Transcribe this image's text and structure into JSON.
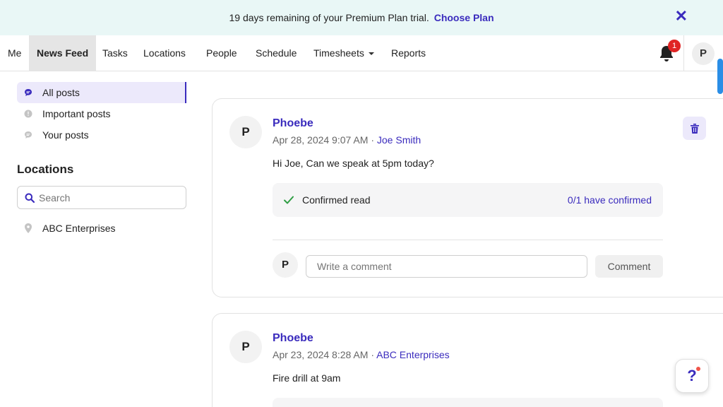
{
  "banner": {
    "text": "19 days remaining of your Premium Plan trial.",
    "link": "Choose Plan",
    "close_icon": "close-icon"
  },
  "nav": {
    "items": [
      {
        "label": "Me"
      },
      {
        "label": "News Feed",
        "active": true
      },
      {
        "label": "Tasks"
      },
      {
        "label": "Locations"
      },
      {
        "label": "People"
      },
      {
        "label": "Schedule"
      },
      {
        "label": "Timesheets",
        "dropdown": true
      },
      {
        "label": "Reports"
      }
    ],
    "notification_count": "1",
    "avatar_initial": "P"
  },
  "sidebar": {
    "filters": [
      {
        "label": "All posts",
        "icon": "chat-bubble-icon",
        "active": true
      },
      {
        "label": "Important posts",
        "icon": "alert-circle-icon"
      },
      {
        "label": "Your posts",
        "icon": "chat-bubble-icon"
      }
    ],
    "locations_heading": "Locations",
    "search_placeholder": "Search",
    "locations": [
      {
        "label": "ABC Enterprises",
        "icon": "map-pin-icon"
      }
    ]
  },
  "posts": [
    {
      "avatar": "P",
      "author": "Phoebe",
      "date": "Apr 28, 2024 9:07 AM",
      "separator": "·",
      "tag": "Joe Smith",
      "body": "Hi Joe, Can we speak at 5pm today?",
      "confirm_label": "Confirmed read",
      "confirm_count": "0/1 have confirmed",
      "comment_avatar": "P",
      "comment_placeholder": "Write a comment",
      "comment_button": "Comment"
    },
    {
      "avatar": "P",
      "author": "Phoebe",
      "date": "Apr 23, 2024 8:28 AM",
      "separator": "·",
      "tag": "ABC Enterprises",
      "body": "Fire drill at 9am"
    }
  ],
  "help_button": "?",
  "colors": {
    "accent": "#3a2bbd",
    "banner_bg": "#e9f7f6",
    "active_bg": "#ece9fb",
    "badge": "#e02424"
  }
}
